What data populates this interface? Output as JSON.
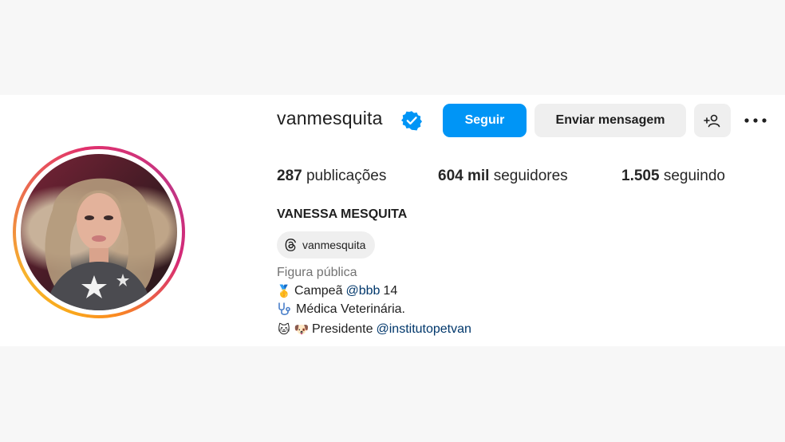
{
  "profile": {
    "username": "vanmesquita",
    "verified": true,
    "full_name": "VANESSA MESQUITA",
    "threads_handle": "vanmesquita",
    "category": "Figura pública"
  },
  "actions": {
    "follow_label": "Seguir",
    "message_label": "Enviar mensagem",
    "suggest_icon": "add-person-icon",
    "more_icon": "more-options-icon"
  },
  "stats": {
    "posts_count": "287",
    "posts_label": "publicações",
    "followers_count": "604 mil",
    "followers_label": "seguidores",
    "following_count": "1.505",
    "following_label": "seguindo"
  },
  "bio": {
    "line1_emoji": "🥇",
    "line1_text": "Campeã",
    "line1_mention": "@bbb",
    "line1_suffix": "14",
    "line2_icon": "stethoscope-icon",
    "line2_text": "Médica Veterinária.",
    "line3_emoji_a": "🐱",
    "line3_emoji_b": "🐶",
    "line3_text": "Presidente",
    "line3_mention": "@institutopetvan"
  },
  "colors": {
    "follow_button": "#0095f6",
    "verified_badge": "#0095f6",
    "mention": "#00376b",
    "secondary_text": "#737373"
  }
}
